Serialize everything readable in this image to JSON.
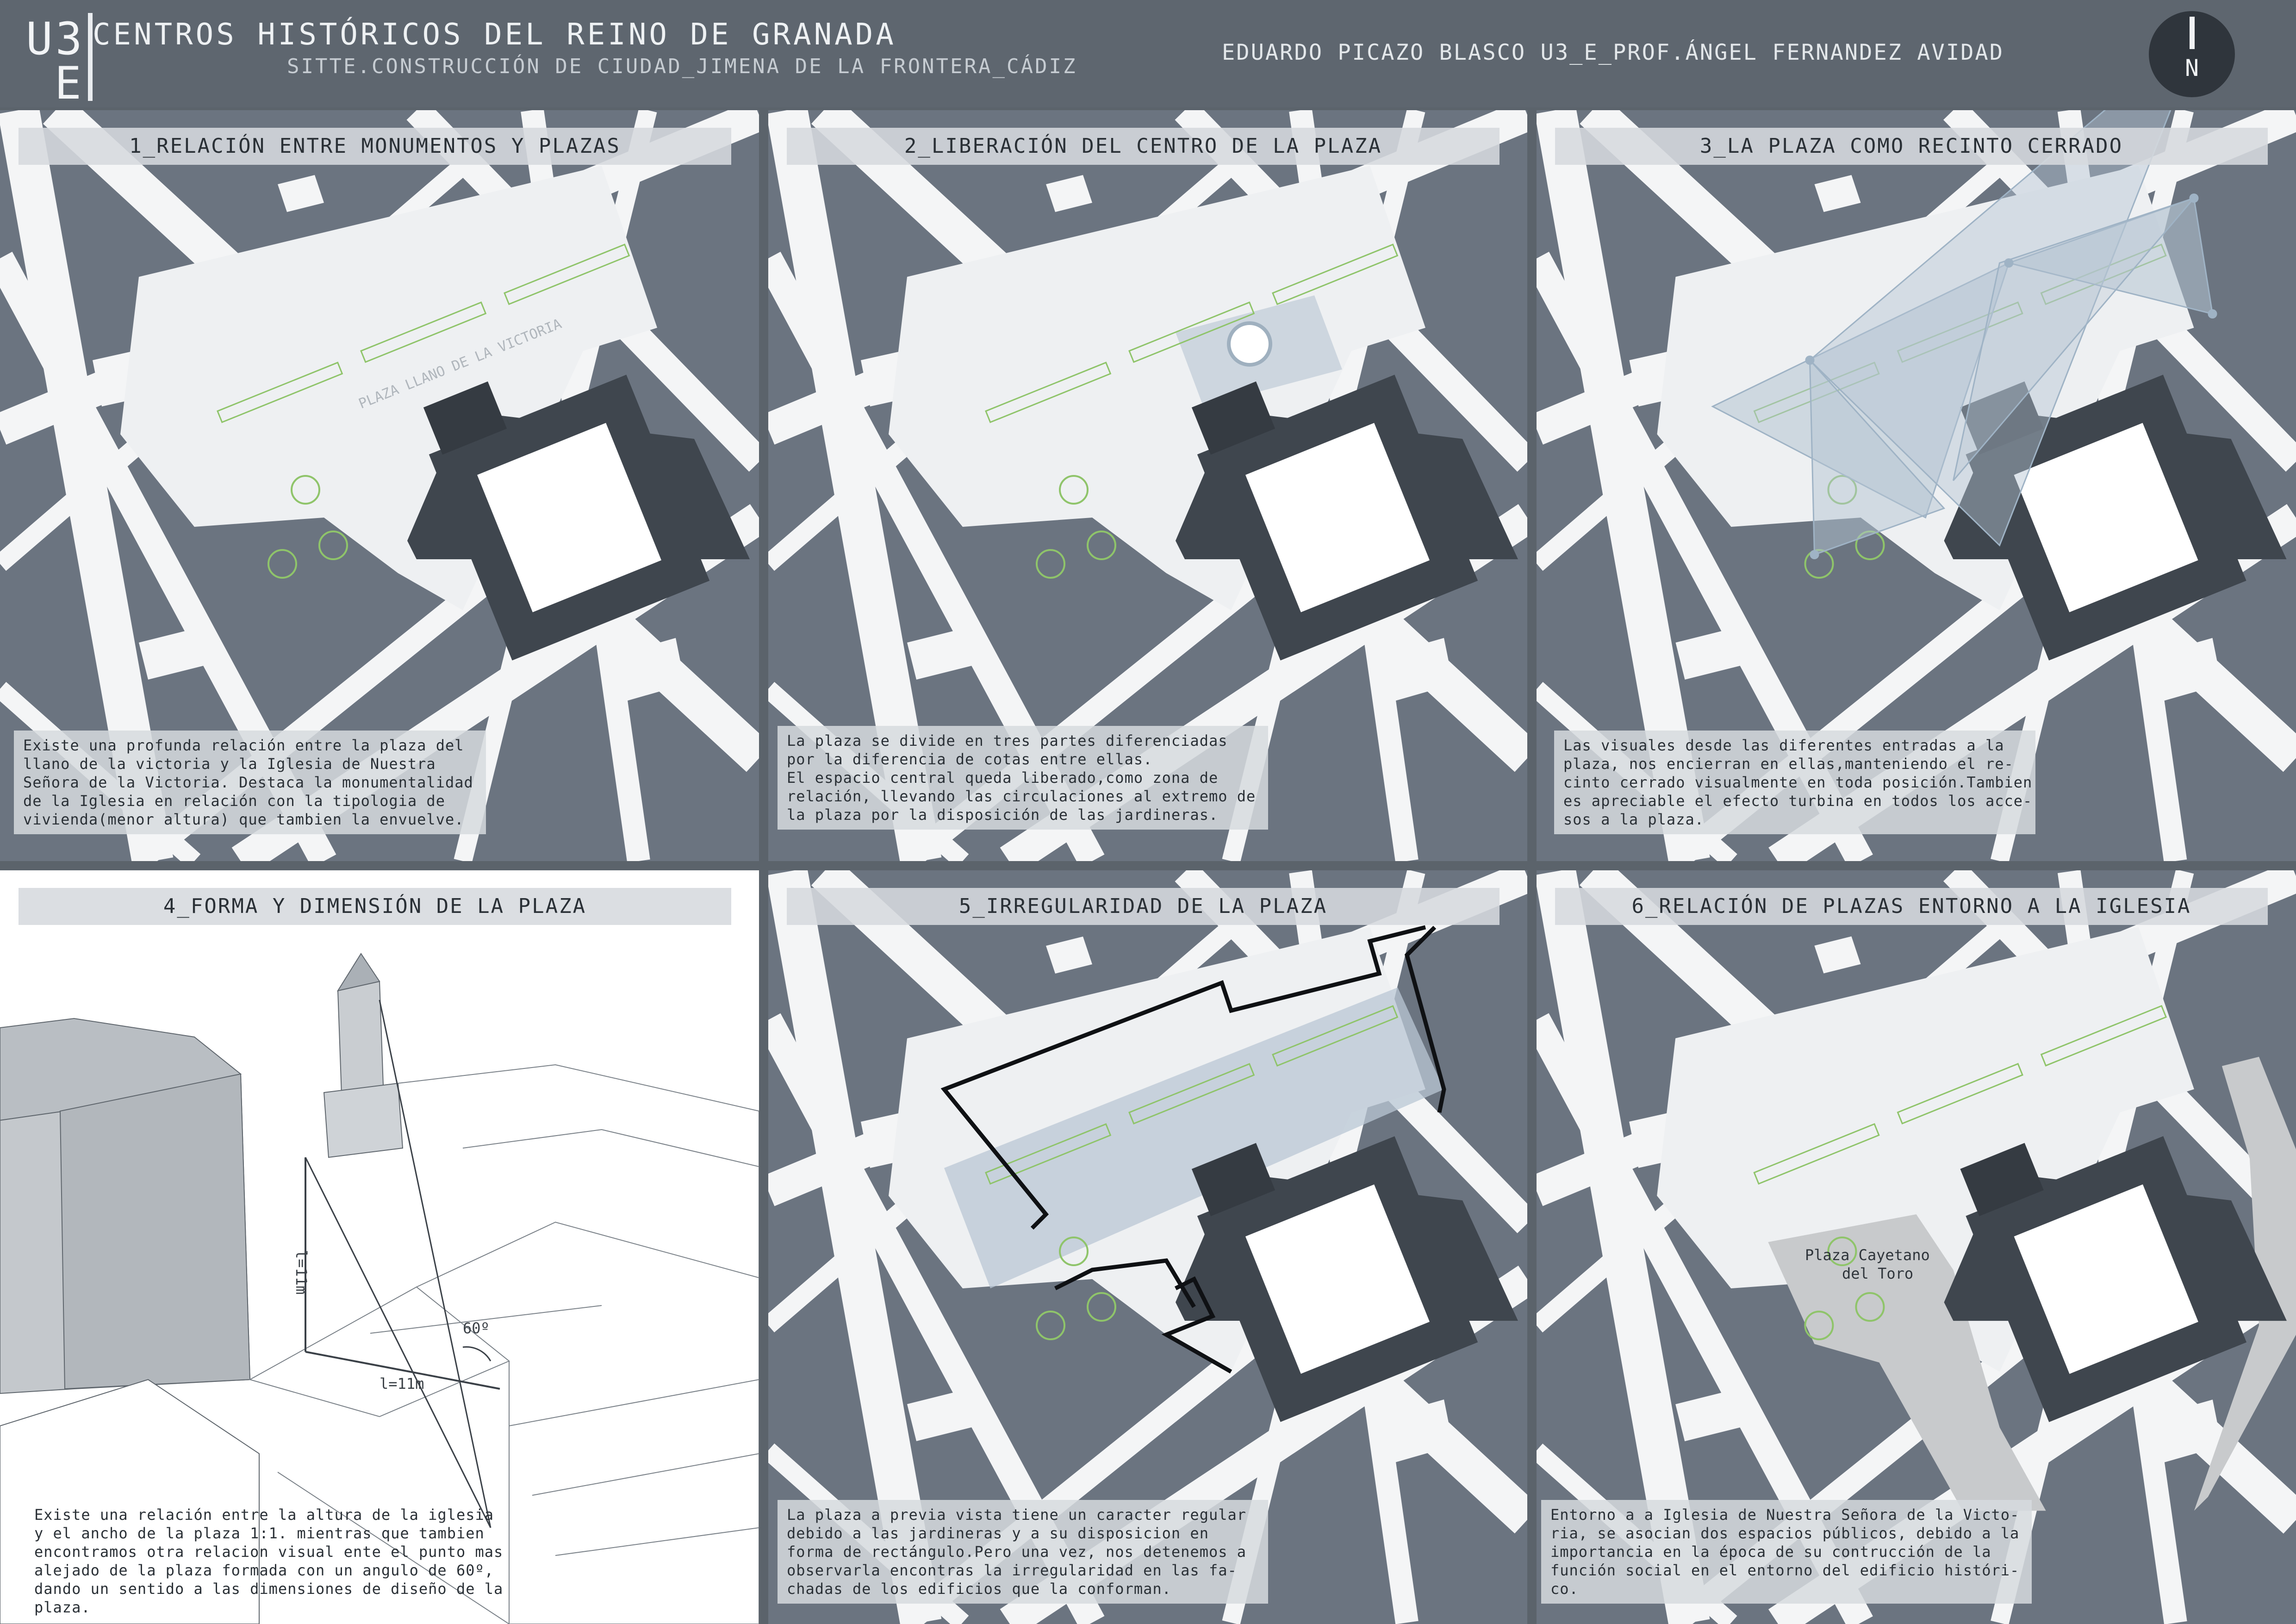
{
  "header": {
    "logo_line1": "U3",
    "logo_line2": "E",
    "title": "CENTROS HISTÓRICOS DEL REINO DE GRANADA",
    "subtitle": "SITTE.CONSTRUCCIÓN DE CIUDAD_JIMENA DE LA FRONTERA_CÁDIZ",
    "author": "EDUARDO PICAZO BLASCO U3_E_PROF.ÁNGEL FERNANDEZ AVIDAD",
    "north_label": "N"
  },
  "colors": {
    "background": "#5b636b",
    "block": "#6b7480",
    "street": "#f4f5f6",
    "church": "#3f464e",
    "highlight": "#b4c4d2",
    "planter": "#8fc46a",
    "caption_box": "#d6dade"
  },
  "panels": [
    {
      "title": "1_RELACIÓN ENTRE MONUMENTOS Y PLAZAS",
      "map_label": "PLAZA LLANO DE LA VICTORIA",
      "description": [
        "Existe una profunda relación entre la plaza del",
        "llano de la victoria y la Iglesia de Nuestra",
        "Señora de la Victoria. Destaca la monumentalidad",
        "de la Iglesia  en relación con la tipologia de",
        "vivienda(menor altura) que tambien la envuelve."
      ]
    },
    {
      "title": "2_LIBERACIÓN DEL CENTRO DE LA PLAZA",
      "description": [
        "La plaza se divide en tres partes diferenciadas",
        "por la diferencia de cotas entre ellas.",
        "El espacio central queda liberado,como zona de",
        "relación, llevando las circulaciones al extremo de",
        "la plaza por la disposición de las jardineras."
      ]
    },
    {
      "title": "3_LA PLAZA COMO RECINTO CERRADO",
      "description": [
        "Las visuales desde las diferentes entradas a la",
        "plaza, nos encierran en ellas,manteniendo el re-",
        "cinto cerrado visualmente en toda posición.Tambien",
        "es apreciable el efecto turbina en todos los acce-",
        "sos a la plaza."
      ]
    },
    {
      "title": "4_FORMA Y DIMENSIÓN DE LA PLAZA",
      "height_label": "l=11m",
      "width_label": "l=11m",
      "angle_label": "60º",
      "description": [
        "Existe una relación entre la altura de la iglesia",
        "y el ancho de la plaza 1:1. mientras que tambien",
        "encontramos otra relacion visual ente el punto mas",
        "alejado de la plaza formada con un angulo de 60º,",
        "dando un sentido a las dimensiones de diseño de la",
        "plaza."
      ]
    },
    {
      "title": "5_IRREGULARIDAD DE LA PLAZA",
      "description": [
        "La plaza a previa vista tiene un caracter regular",
        "debido a las jardineras y a su disposicion en",
        "forma de rectángulo.Pero una vez, nos detenemos a",
        "observarla encontras la irregularidad en las fa-",
        "chadas de los edificios que la conforman."
      ]
    },
    {
      "title": "6_RELACIÓN DE PLAZAS ENTORNO A LA IGLESIA",
      "plaza_label_1": "Plaza Cayetano",
      "plaza_label_2": "del Toro",
      "description": [
        "Entorno a a Iglesia de Nuestra Señora de la Victo-",
        "ria, se asocian dos espacios públicos, debido a la",
        "importancia en la época de su contrucción de la",
        "función social en el entorno del edificio históri-",
        "co."
      ]
    }
  ]
}
